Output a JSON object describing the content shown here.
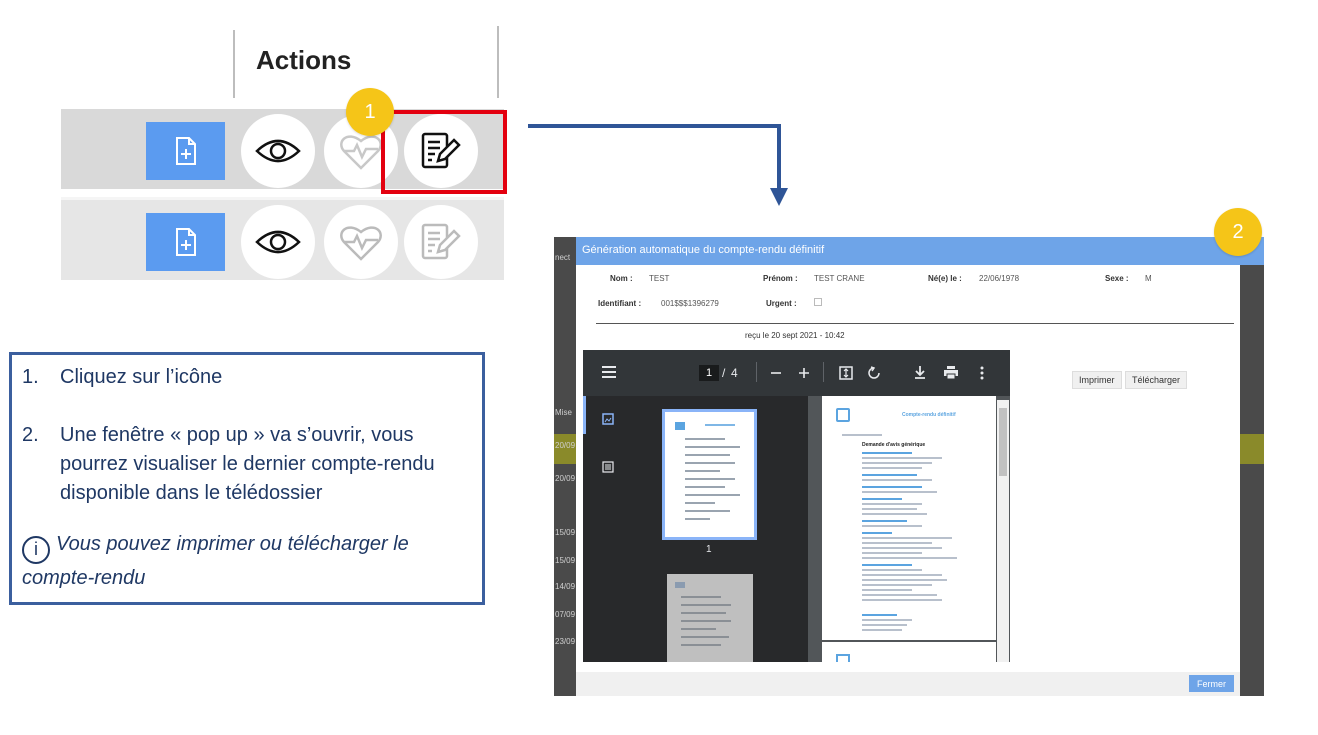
{
  "actions_panel": {
    "title": "Actions",
    "step1_badge": "1"
  },
  "instructions": {
    "items": [
      {
        "num": "1.",
        "text": "Cliquez sur l’icône"
      },
      {
        "num": "2.",
        "text": "Une fenêtre « pop up » va s’ouvrir, vous pourrez visualiser le dernier compte-rendu disponible dans le télédossier"
      }
    ],
    "info_icon": "i",
    "note": "Vous pouvez imprimer ou télécharger le compte-rendu"
  },
  "popup": {
    "step2_badge": "2",
    "title": "Génération automatique du compte-rendu définitif",
    "bg_header_text": "nect",
    "fields": {
      "nom_label": "Nom :",
      "nom_value": "TEST",
      "prenom_label": "Prénom :",
      "prenom_value": "TEST CRANE",
      "naissance_label": "Né(e) le :",
      "naissance_value": "22/06/1978",
      "sexe_label": "Sexe :",
      "sexe_value": "M",
      "identifiant_label": "Identifiant :",
      "identifiant_value": "001$$$1396279",
      "urgent_label": "Urgent :"
    },
    "received": "reçu le 20 sept 2021 - 10:42",
    "pdf": {
      "page_current": "1",
      "page_sep": "/",
      "page_total": "4",
      "thumb_label": "1",
      "doc_title": "Compte-rendu définitif",
      "doc_heading": "Demande d'avis générique"
    },
    "print_label": "Imprimer",
    "download_label": "Télécharger",
    "close_label": "Fermer",
    "bg_left_labels": [
      "Mise",
      "20/09",
      "20/09",
      "15/09",
      "15/09",
      "14/09",
      "07/09",
      "23/09"
    ]
  },
  "colors": {
    "accent_blue": "#5b9bf0",
    "highlight_red": "#e3000f",
    "badge_yellow": "#f5c518",
    "arrow_navy": "#2f5597",
    "text_navy": "#1f3864"
  },
  "icons": [
    "add-document-icon",
    "eye-icon",
    "heart-pulse-icon",
    "edit-document-icon",
    "menu-icon",
    "minus-icon",
    "plus-icon",
    "fit-page-icon",
    "rotate-icon",
    "download-icon",
    "print-icon",
    "more-icon",
    "thumbnail-icon",
    "outline-icon",
    "info-icon"
  ]
}
